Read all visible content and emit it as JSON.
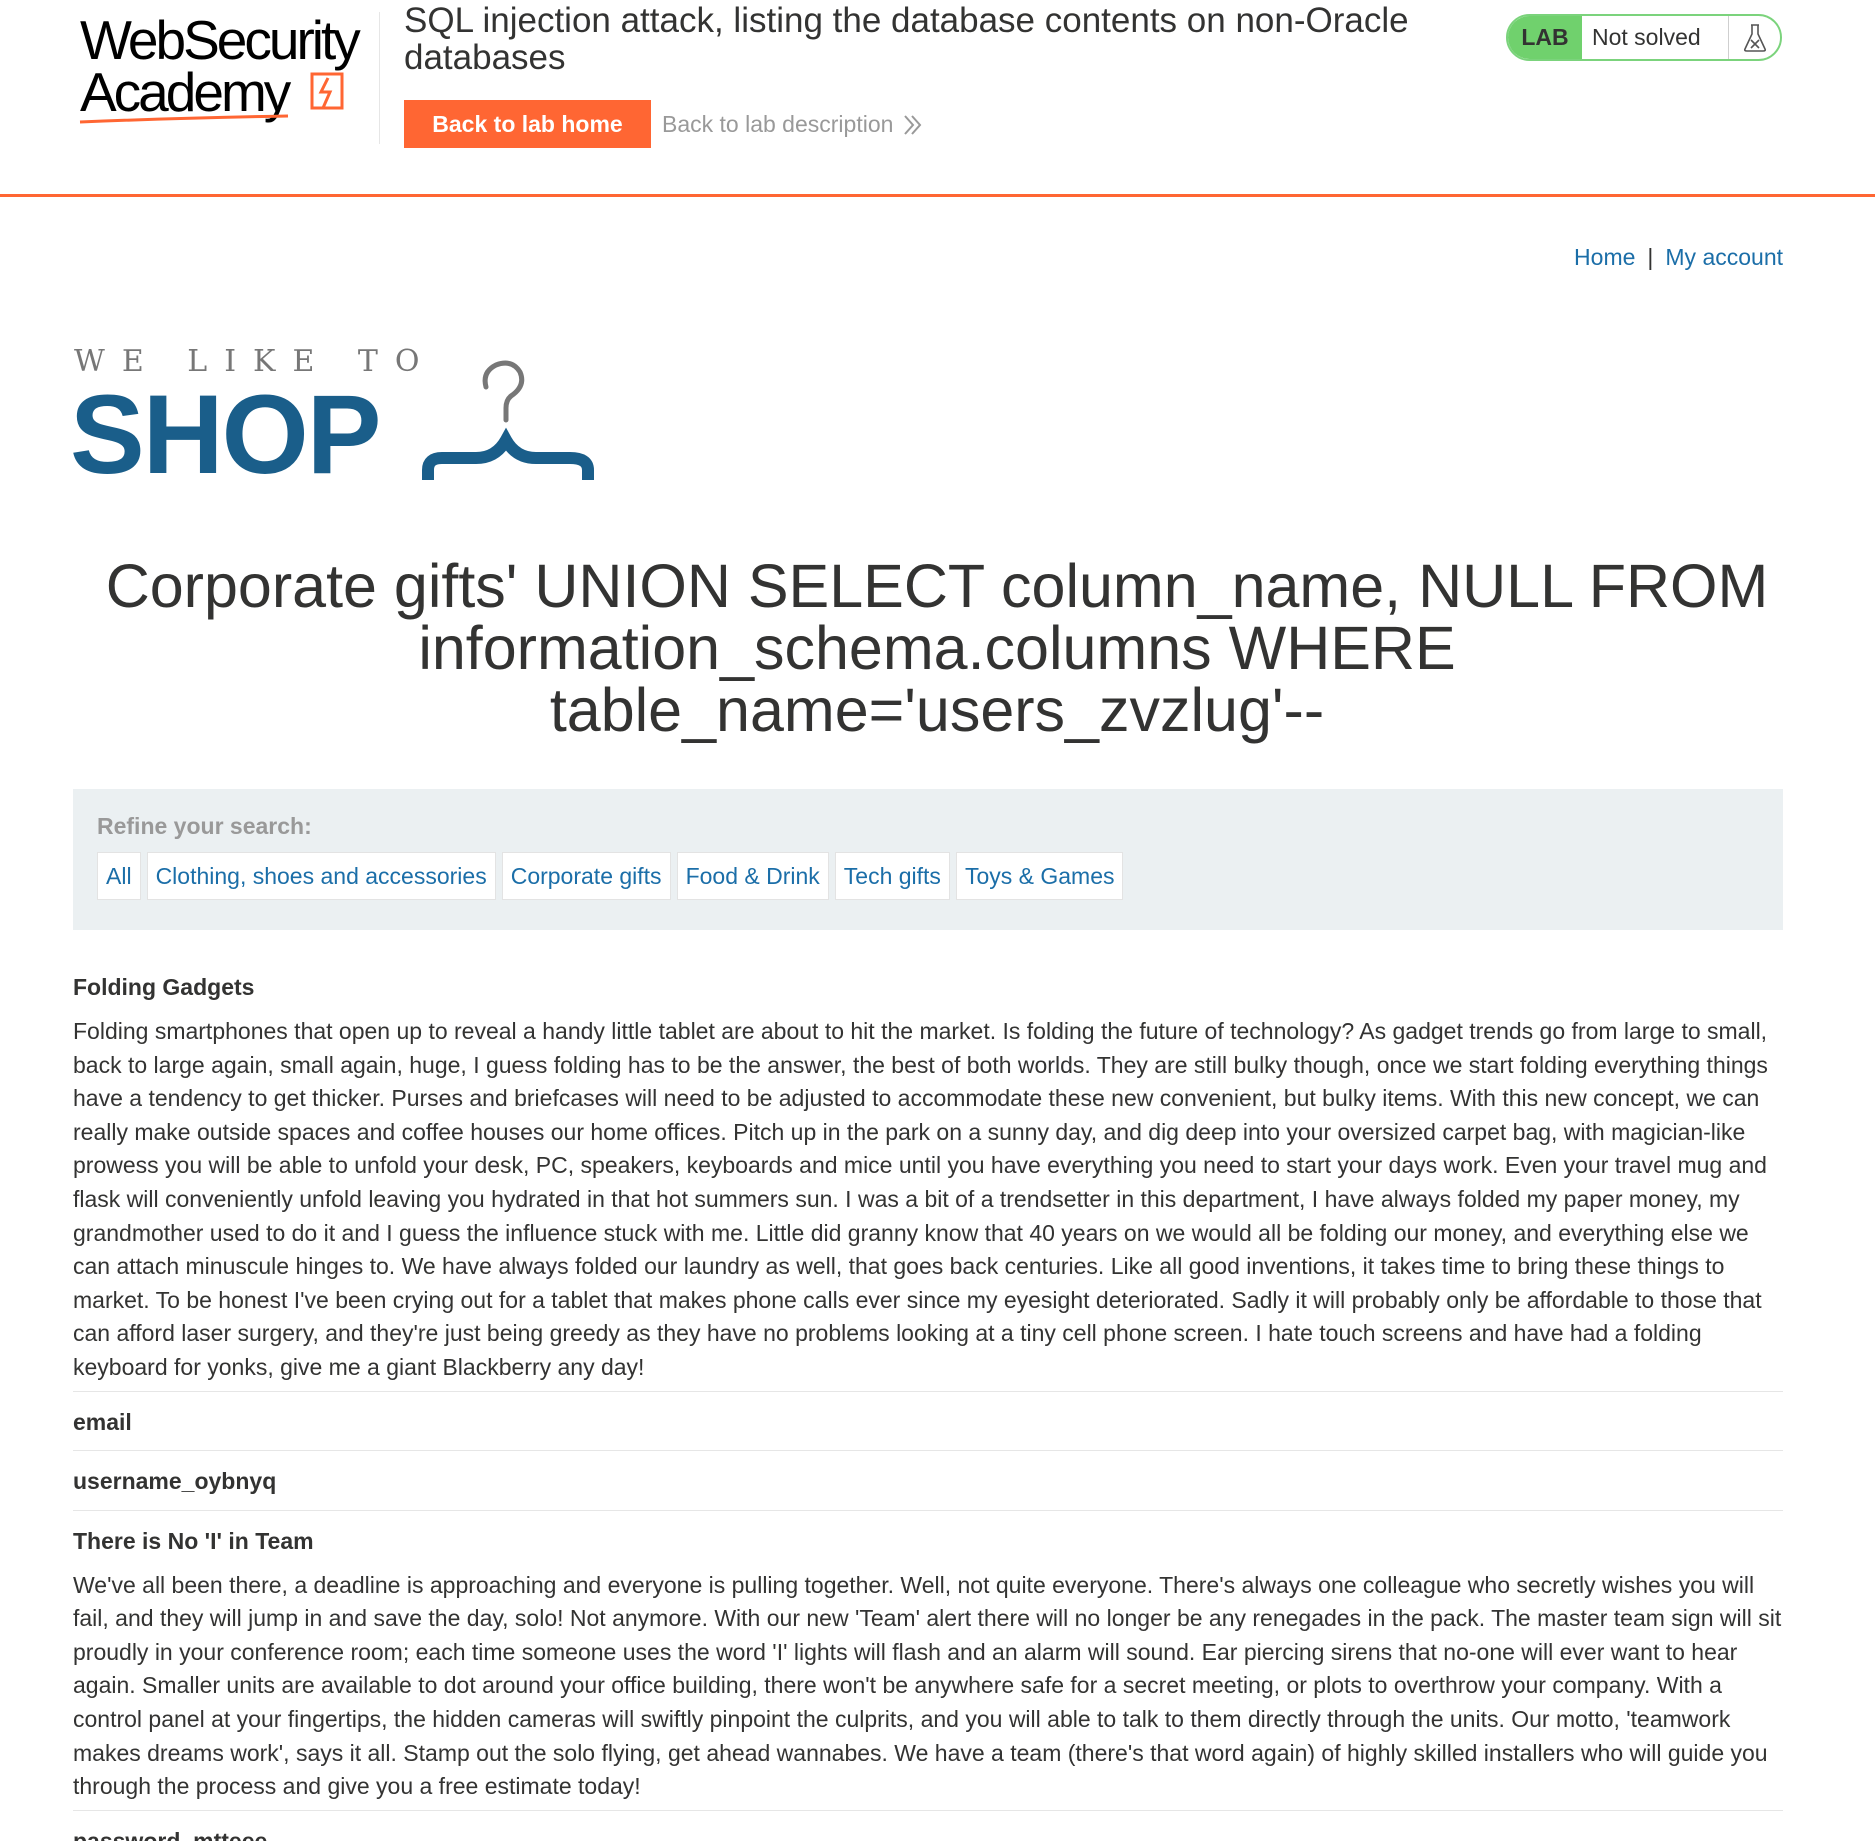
{
  "academy": {
    "logo_line1": "WebSecurity",
    "logo_line2": "Academy",
    "lab_title": "SQL injection attack, listing the database contents on non-Oracle databases",
    "back_home_label": "Back to lab home",
    "back_description_label": "Back to lab description",
    "lab_badge": "LAB",
    "lab_status": "Not solved",
    "accent_color": "#ff6633",
    "status_color": "#70d16d"
  },
  "nav": {
    "home_label": "Home",
    "separator": "|",
    "account_label": "My account"
  },
  "shop_logo": {
    "tagline": "WE LIKE TO",
    "word": "SHOP",
    "brand_color": "#1a5e8a"
  },
  "search": {
    "title": "Corporate gifts' UNION SELECT column_name, NULL FROM information_schema.columns WHERE table_name='users_zvzlug'--"
  },
  "filters": {
    "label": "Refine your search:",
    "items": [
      "All",
      "Clothing, shoes and accessories",
      "Corporate gifts",
      "Food & Drink",
      "Tech gifts",
      "Toys & Games"
    ]
  },
  "results": [
    {
      "title": "Folding Gadgets",
      "body": "Folding smartphones that open up to reveal a handy little tablet are about to hit the market. Is folding the future of technology? As gadget trends go from large to small, back to large again, small again, huge, I guess folding has to be the answer, the best of both worlds. They are still bulky though, once we start folding everything things have a tendency to get thicker. Purses and briefcases will need to be adjusted to accommodate these new convenient, but bulky items. With this new concept, we can really make outside spaces and coffee houses our home offices. Pitch up in the park on a sunny day, and dig deep into your oversized carpet bag, with magician-like prowess you will be able to unfold your desk, PC, speakers, keyboards and mice until you have everything you need to start your days work. Even your travel mug and flask will conveniently unfold leaving you hydrated in that hot summers sun. I was a bit of a trendsetter in this department, I have always folded my paper money, my grandmother used to do it and I guess the influence stuck with me. Little did granny know that 40 years on we would all be folding our money, and everything else we can attach minuscule hinges to. We have always folded our laundry as well, that goes back centuries. Like all good inventions, it takes time to bring these things to market. To be honest I've been crying out for a tablet that makes phone calls ever since my eyesight deteriorated. Sadly it will probably only be affordable to those that can afford laser surgery, and they're just being greedy as they have no problems looking at a tiny cell phone screen. I hate touch screens and have had a folding keyboard for yonks, give me a giant Blackberry any day!"
    },
    {
      "title": "email"
    },
    {
      "title": "username_oybnyq"
    },
    {
      "title": "There is No 'I' in Team",
      "body": "We've all been there, a deadline is approaching and everyone is pulling together. Well, not quite everyone. There's always one colleague who secretly wishes you will fail, and they will jump in and save the day, solo! Not anymore. With our new 'Team' alert there will no longer be any renegades in the pack. The master team sign will sit proudly in your conference room; each time someone uses the word 'I' lights will flash and an alarm will sound. Ear piercing sirens that no-one will ever want to hear again. Smaller units are available to dot around your office building, there won't be anywhere safe for a secret meeting, or plots to overthrow your company. With a control panel at your fingertips, the hidden cameras will swiftly pinpoint the culprits, and you will able to talk to them directly through the units. Our motto, 'teamwork makes dreams work', says it all. Stamp out the solo flying, get ahead wannabes. We have a team (there's that word again) of highly skilled installers who will guide you through the process and give you a free estimate today!"
    },
    {
      "title": "password_mtteee"
    }
  ]
}
